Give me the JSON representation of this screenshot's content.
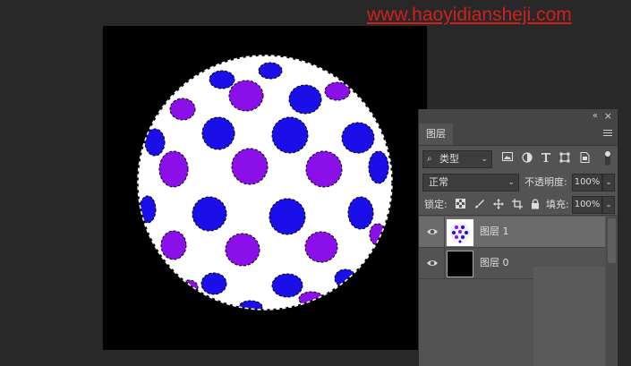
{
  "watermark": "www.haoyidiansheji.com",
  "colors": {
    "workspace": "#282828",
    "canvas": "#000000",
    "sphere": "#ffffff",
    "dot_blue": "#1a0fe8",
    "dot_purple": "#8a0fe8",
    "panel": "#535353",
    "accent_watermark": "#d0201e"
  },
  "panel": {
    "collapse_icon": "«",
    "close_icon": "×",
    "tab_label": "图层",
    "menu_icon": "hamburger-icon",
    "filter": {
      "search_icon": "⌕",
      "kind_label": "类型",
      "dropdown_icon": "⌄",
      "icons": [
        "image-filter-icon",
        "adjustment-filter-icon",
        "type-filter-icon",
        "shape-filter-icon",
        "smart-object-filter-icon",
        "filter-toggle"
      ]
    },
    "blend": {
      "mode": "正常",
      "opacity_label": "不透明度:",
      "opacity_value": "100%"
    },
    "lock": {
      "label": "锁定:",
      "icons": [
        "lock-transparent-icon",
        "lock-paint-icon",
        "lock-move-icon",
        "lock-artboard-icon",
        "lock-all-icon"
      ],
      "fill_label": "填充:",
      "fill_value": "100%"
    },
    "layers": [
      {
        "name": "图层 1",
        "visible": true,
        "selected": true
      },
      {
        "name": "图层 0",
        "visible": true,
        "selected": false
      }
    ]
  }
}
